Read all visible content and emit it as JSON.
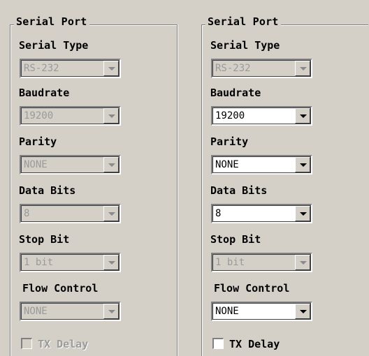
{
  "panels": [
    {
      "legend": "Serial Port",
      "serial_type_label": "Serial Type",
      "serial_type_value": "RS-232",
      "baudrate_label": "Baudrate",
      "baudrate_value": "19200",
      "parity_label": "Parity",
      "parity_value": "NONE",
      "data_bits_label": "Data Bits",
      "data_bits_value": "8",
      "stop_bit_label": "Stop Bit",
      "stop_bit_value": "1 bit",
      "flow_control_label": "Flow Control",
      "flow_control_value": "NONE",
      "tx_delay_label": "TX Delay",
      "tx_delay_checked": false,
      "state": "all disabled"
    },
    {
      "legend": "Serial Port",
      "serial_type_label": "Serial Type",
      "serial_type_value": "RS-232",
      "baudrate_label": "Baudrate",
      "baudrate_value": "19200",
      "parity_label": "Parity",
      "parity_value": "NONE",
      "data_bits_label": "Data Bits",
      "data_bits_value": "8",
      "stop_bit_label": "Stop Bit",
      "stop_bit_value": "1 bit",
      "flow_control_label": "Flow Control",
      "flow_control_value": "NONE",
      "tx_delay_label": "TX Delay",
      "tx_delay_checked": false,
      "state": "serial type and stop bit disabled"
    }
  ],
  "colors": {
    "window_bg": "#d4d0c8",
    "field_bg": "#ffffff",
    "disabled_text": "#9a9a9a"
  },
  "icons": {
    "dropdown": "chevron-down-icon"
  }
}
